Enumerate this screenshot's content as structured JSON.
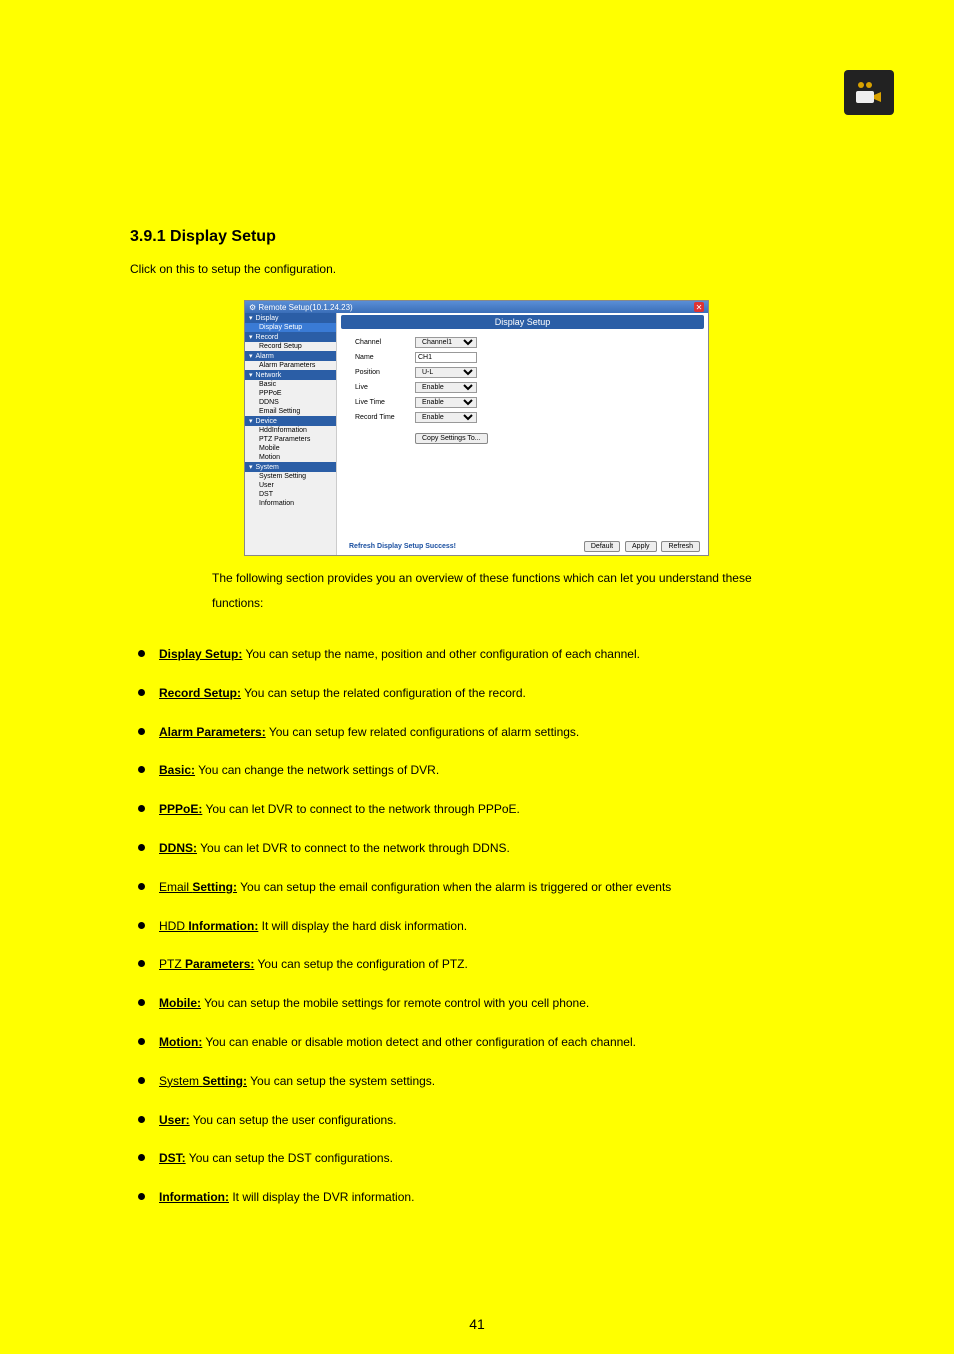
{
  "section_number": "3.9.1",
  "section_title": "Display Setup",
  "section_desc": "Click on this to setup the configuration.",
  "window": {
    "title": "Remote Setup(10.1.24.23)",
    "banner": "Display Setup",
    "sidebar": {
      "groups": [
        {
          "label": "Display",
          "items": [
            "Display Setup"
          ]
        },
        {
          "label": "Record",
          "items": [
            "Record Setup"
          ]
        },
        {
          "label": "Alarm",
          "items": [
            "Alarm Parameters"
          ]
        },
        {
          "label": "Network",
          "items": [
            "Basic",
            "PPPoE",
            "DDNS",
            "Email Setting"
          ]
        },
        {
          "label": "Device",
          "items": [
            "HddInformation",
            "PTZ Parameters",
            "Mobile",
            "Motion"
          ]
        },
        {
          "label": "System",
          "items": [
            "System Setting",
            "User",
            "DST",
            "Information"
          ]
        }
      ],
      "active": "Display Setup"
    },
    "form": {
      "channel_label": "Channel",
      "channel_value": "Channel1",
      "name_label": "Name",
      "name_value": "CH1",
      "position_label": "Position",
      "position_value": "U-L",
      "live_label": "Live",
      "live_value": "Enable",
      "livetime_label": "Live Time",
      "livetime_value": "Enable",
      "recordtime_label": "Record Time",
      "recordtime_value": "Enable",
      "copy_label": "Copy Settings To..."
    },
    "footer": {
      "status": "Refresh Display Setup Success!",
      "default_btn": "Default",
      "apply_btn": "Apply",
      "refresh_btn": "Refresh"
    }
  },
  "intro_line1": "The following section provides you an overview of these functions which can let you understand these",
  "intro_line2": "functions:",
  "bullets": [
    {
      "label": "Display Setup:",
      "desc": "You can setup the name, position and other configuration of each channel."
    },
    {
      "label": "Record Setup:",
      "desc": "You can setup the related configuration of the record."
    },
    {
      "label": "Alarm Parameters:",
      "desc": "You can setup few related configurations of alarm settings."
    },
    {
      "label": "Basic:",
      "desc": "You can change the network settings of DVR."
    },
    {
      "label": "PPPoE:",
      "desc": "You can let DVR to connect to the network through PPPoE."
    },
    {
      "label": "DDNS:",
      "desc": "You can let DVR to connect to the network through DDNS."
    },
    {
      "label": "Email ",
      "label2": "Setting:",
      "desc": "You can setup the email configuration when the alarm is triggered or other events"
    },
    {
      "label": "HDD ",
      "label2": "Information:",
      "desc": "It will display the hard disk information."
    },
    {
      "label": "PTZ ",
      "label2": "Parameters:",
      "desc": "You can setup the configuration of PTZ."
    },
    {
      "label": "Mobile:",
      "desc": "You can setup the mobile settings for remote control with you cell phone."
    },
    {
      "label": "Motion:",
      "desc": "You can enable or disable motion detect and other configuration of each channel."
    },
    {
      "label": "System ",
      "label2": "Setting:",
      "desc": "You can setup the system settings."
    },
    {
      "label": "User:",
      "desc": "You can setup the user configurations."
    },
    {
      "label": "DST:",
      "desc": "You can setup the DST configurations."
    },
    {
      "label": "Information:",
      "desc": "It will display the DVR information."
    }
  ],
  "page_number": "41"
}
